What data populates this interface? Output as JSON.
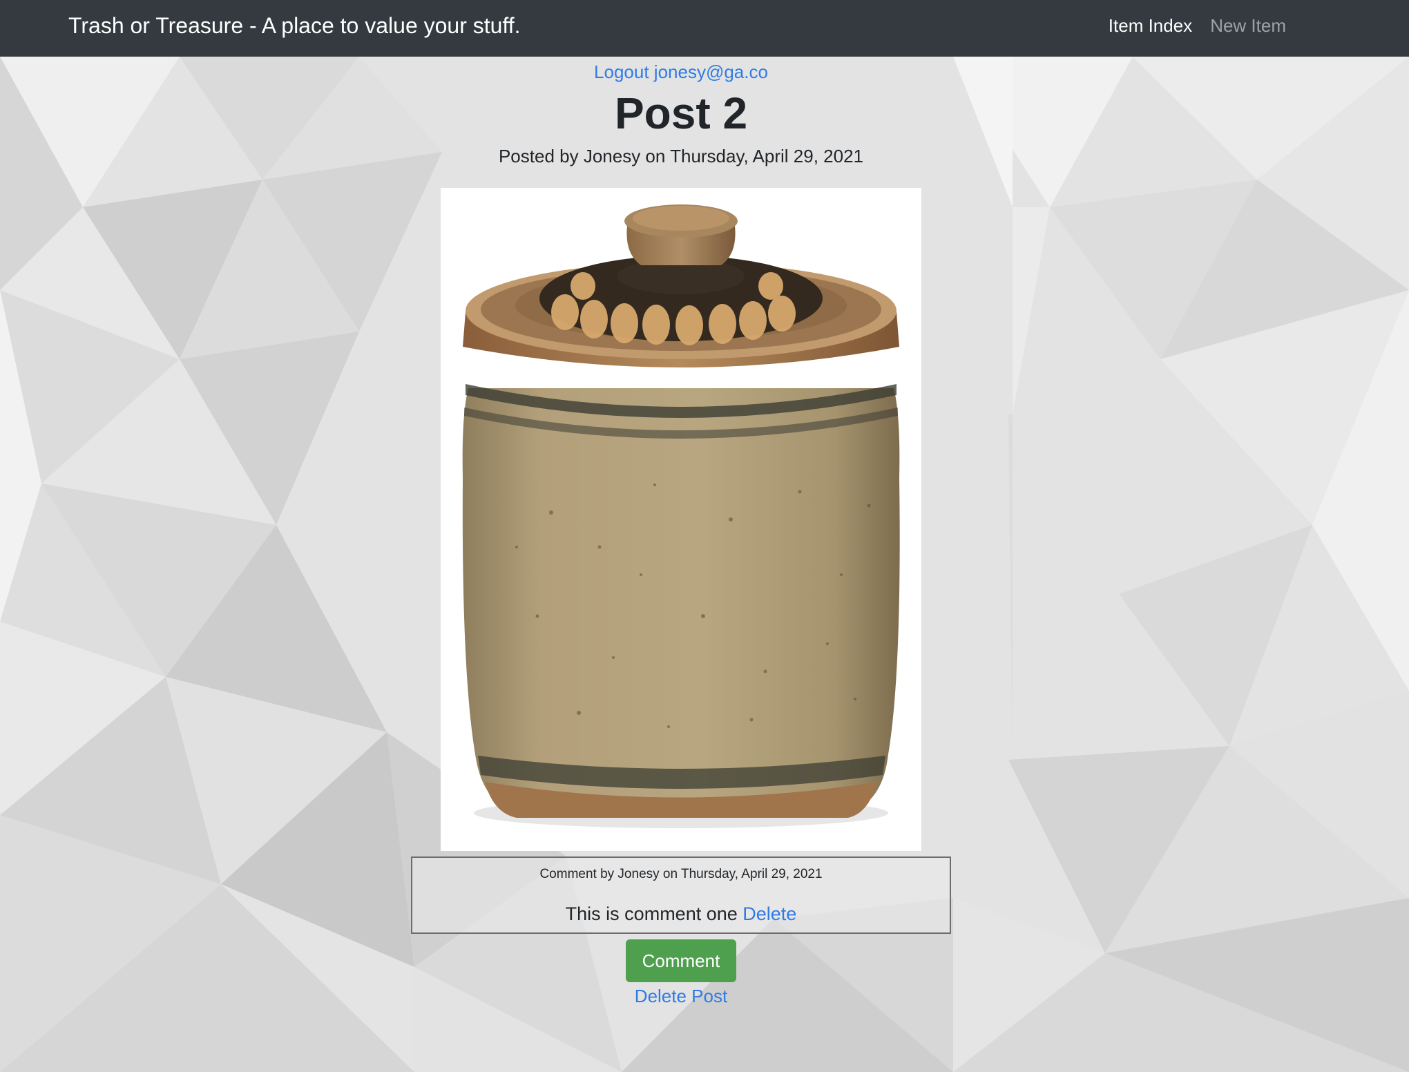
{
  "navbar": {
    "brand": "Trash or Treasure - A place to value your stuff.",
    "links": [
      {
        "label": "Item Index",
        "state": "active"
      },
      {
        "label": "New Item",
        "state": "muted"
      }
    ]
  },
  "auth": {
    "logout_label": "Logout jonesy@ga.co"
  },
  "post": {
    "title": "Post 2",
    "posted_by": "Posted by Jonesy on Thursday, April 29, 2021",
    "image_subject": "ceramic-lidded-jar"
  },
  "comments": [
    {
      "meta": "Comment by Jonesy on Thursday, April 29, 2021",
      "text": "This is comment one",
      "delete_label": "Delete"
    }
  ],
  "actions": {
    "comment_label": "Comment",
    "delete_post_label": "Delete Post"
  },
  "colors": {
    "navbar_bg": "#343a40",
    "link": "#2f7be6",
    "comment_button": "#4e9f4e",
    "page_bg": "#e2e2e2"
  }
}
